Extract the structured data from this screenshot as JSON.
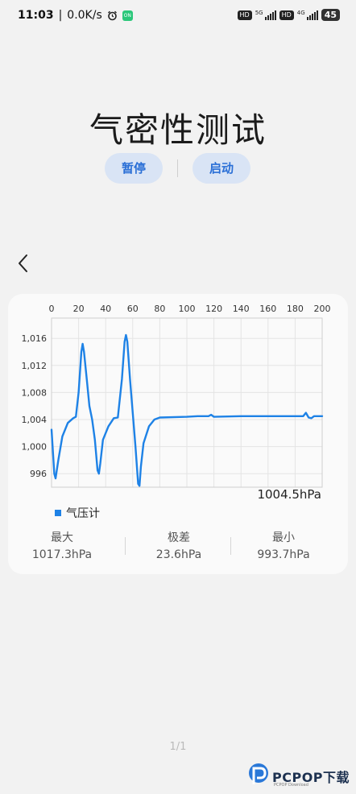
{
  "status_bar": {
    "time": "11:03",
    "speed": "0.0K/s",
    "hd1": "HD",
    "net1": "5G",
    "hd2": "HD",
    "net2": "4G",
    "battery": "45"
  },
  "page": {
    "title": "气密性测试",
    "pause_label": "暂停",
    "start_label": "启动",
    "back_icon": "chevron-left-icon"
  },
  "chart_data": {
    "type": "line",
    "x_ticks": [
      "0",
      "20",
      "40",
      "60",
      "80",
      "100",
      "120",
      "140",
      "160",
      "180",
      "200"
    ],
    "y_ticks": [
      "996",
      "1,000",
      "1,004",
      "1,008",
      "1,012",
      "1,016"
    ],
    "xlim": [
      0,
      200
    ],
    "ylim": [
      994,
      1019
    ],
    "grid": true,
    "legend_position": "bottom-left",
    "series": [
      {
        "name": "气压计",
        "color": "#1e82e6",
        "points": [
          [
            0,
            1002.5
          ],
          [
            2,
            996
          ],
          [
            3,
            995.3
          ],
          [
            5,
            998
          ],
          [
            8,
            1001.5
          ],
          [
            12,
            1003.5
          ],
          [
            16,
            1004.2
          ],
          [
            18,
            1004.4
          ],
          [
            20,
            1008
          ],
          [
            22,
            1014
          ],
          [
            23,
            1015.2
          ],
          [
            24,
            1014
          ],
          [
            26,
            1010
          ],
          [
            28,
            1006
          ],
          [
            30,
            1004
          ],
          [
            32,
            1001
          ],
          [
            34,
            996.5
          ],
          [
            35,
            996
          ],
          [
            36,
            997.5
          ],
          [
            38,
            1001
          ],
          [
            42,
            1003
          ],
          [
            46,
            1004.2
          ],
          [
            49,
            1004.3
          ],
          [
            52,
            1010
          ],
          [
            54,
            1015.5
          ],
          [
            55,
            1016.5
          ],
          [
            56,
            1015.5
          ],
          [
            58,
            1010
          ],
          [
            60,
            1005
          ],
          [
            62,
            1000
          ],
          [
            64,
            994.5
          ],
          [
            65,
            994.2
          ],
          [
            66,
            997
          ],
          [
            68,
            1000.5
          ],
          [
            72,
            1003
          ],
          [
            76,
            1004
          ],
          [
            80,
            1004.3
          ],
          [
            100,
            1004.4
          ],
          [
            108,
            1004.5
          ],
          [
            116,
            1004.5
          ],
          [
            118,
            1004.7
          ],
          [
            120,
            1004.4
          ],
          [
            140,
            1004.5
          ],
          [
            170,
            1004.5
          ],
          [
            186,
            1004.5
          ],
          [
            188,
            1005
          ],
          [
            190,
            1004.3
          ],
          [
            192,
            1004.2
          ],
          [
            194,
            1004.5
          ],
          [
            196,
            1004.5
          ],
          [
            200,
            1004.5
          ]
        ]
      }
    ]
  },
  "readings": {
    "current": "1004.5hPa",
    "legend": "气压计",
    "max_label": "最大",
    "max_value": "1017.3hPa",
    "range_label": "极差",
    "range_value": "23.6hPa",
    "min_label": "最小",
    "min_value": "993.7hPa"
  },
  "footer": {
    "page_indicator": "1/1",
    "watermark": "PCPOP下载",
    "watermark_sub": "PCPOP Download"
  }
}
